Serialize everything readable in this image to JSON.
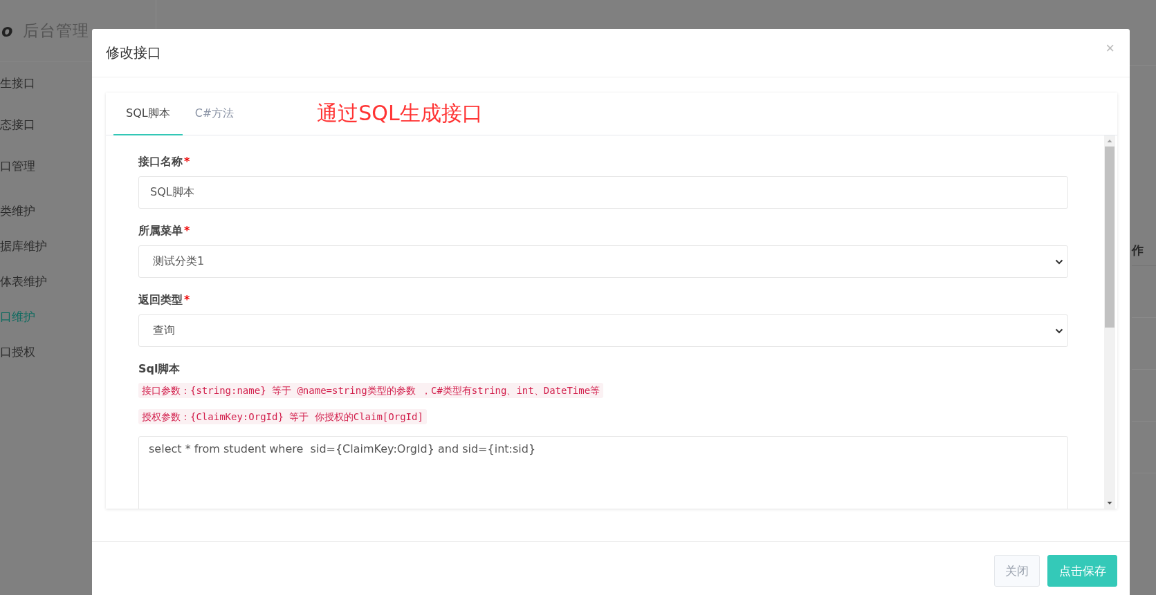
{
  "background": {
    "brand_mark": "o",
    "brand": "后台管理",
    "sidebar": [
      {
        "label": "生接口",
        "selected": false
      },
      {
        "label": "态接口",
        "selected": false
      },
      {
        "label": "口管理",
        "selected": false,
        "children": [
          {
            "label": "类维护",
            "selected": false
          },
          {
            "label": "据库维护",
            "selected": false
          },
          {
            "label": "体表维护",
            "selected": false
          },
          {
            "label": "口维护",
            "selected": true
          },
          {
            "label": "口授权",
            "selected": false
          }
        ]
      }
    ],
    "table_header": "作"
  },
  "dialog": {
    "title": "修改接口",
    "close": "×",
    "tabs": [
      {
        "label": "SQL脚本",
        "selected": true
      },
      {
        "label": "C#方法",
        "selected": false
      }
    ],
    "annotation": "通过SQL生成接口",
    "fields": [
      {
        "kind": "input",
        "label": "接口名称",
        "required_mark": "*",
        "value": "SQL脚本"
      },
      {
        "kind": "select",
        "label": "所属菜单",
        "required_mark": "*",
        "value": "测试分类1"
      },
      {
        "kind": "select",
        "label": "返回类型",
        "required_mark": "*",
        "value": "查询"
      },
      {
        "kind": "textarea",
        "label": "Sql脚本",
        "hints": [
          "接口参数：{string:name} 等于 @name=string类型的参数 ，C#类型有string、int、DateTime等",
          "授权参数：{ClaimKey:OrgId} 等于 你授权的Claim[OrgId]"
        ],
        "value": "select * from student where  sid={ClaimKey:OrgId} and sid={int:sid}"
      }
    ],
    "buttons": [
      {
        "label": "关闭",
        "kind": "secondary"
      },
      {
        "label": "点击保存",
        "kind": "primary"
      }
    ]
  }
}
